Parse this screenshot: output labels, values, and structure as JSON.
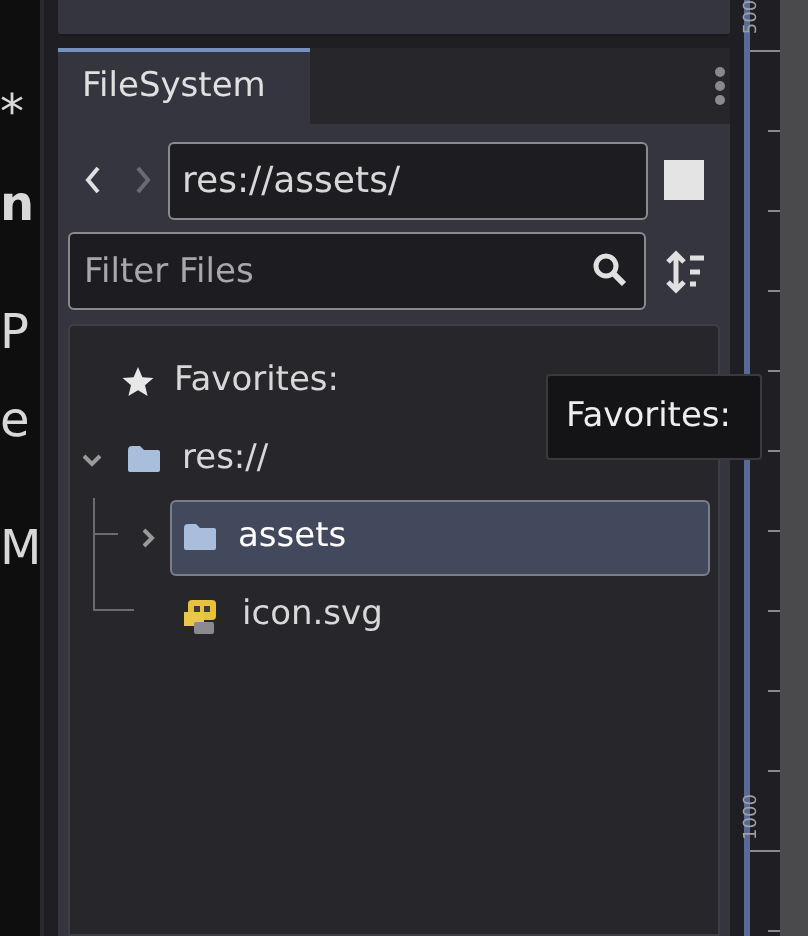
{
  "left_fragments": [
    "*",
    "n",
    "P",
    "e",
    "M"
  ],
  "tabs": [
    {
      "label": "FileSystem",
      "selected": true
    }
  ],
  "path": {
    "value": "res://assets/",
    "back_disabled": false,
    "forward_disabled": true
  },
  "filter": {
    "placeholder": "Filter Files"
  },
  "tree": [
    {
      "kind": "favorites",
      "label": "Favorites:"
    },
    {
      "kind": "folder",
      "label": "res://",
      "expanded": true,
      "selected": false,
      "children": [
        {
          "kind": "folder",
          "label": "assets",
          "expanded": false,
          "selected": true
        },
        {
          "kind": "file",
          "label": "icon.svg",
          "selected": false
        }
      ]
    }
  ],
  "tooltip": "Favorites:",
  "ruler": [
    "500",
    "1000"
  ]
}
